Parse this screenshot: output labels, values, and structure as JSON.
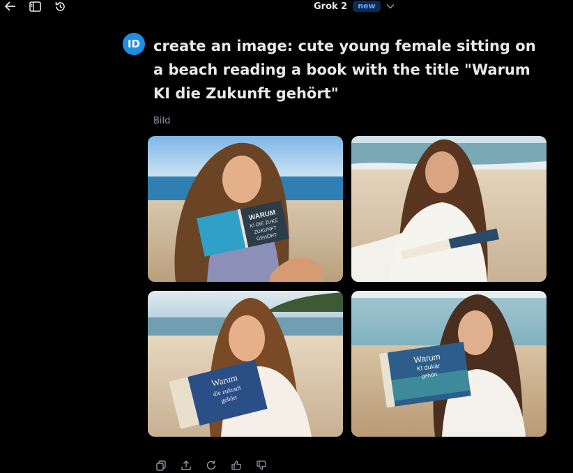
{
  "header": {
    "model_name": "Grok 2",
    "model_badge": "new",
    "icons": [
      "back-arrow-icon",
      "sidebar-toggle-icon",
      "history-icon",
      "chevron-down-icon"
    ]
  },
  "message": {
    "avatar_initials": "ID",
    "prompt": "create an image: cute young female sitting on a beach reading a book with the title \"Warum KI die Zukunft gehört\""
  },
  "result": {
    "type_label": "Bild",
    "images": [
      {
        "book_text": [
          "WARUM",
          "KI DIE ZUKE",
          "ZUKUNFT",
          "GEHÖRT"
        ]
      },
      {
        "book_text": []
      },
      {
        "book_text": [
          "Warum",
          "die zukunft",
          "gehört"
        ]
      },
      {
        "book_text": [
          "Warum",
          "KI dukär",
          "gehört"
        ]
      }
    ]
  },
  "actions": {
    "icons": [
      "copy-icon",
      "share-icon",
      "regenerate-icon",
      "thumbs-up-icon",
      "thumbs-down-icon"
    ]
  },
  "colors": {
    "background": "#000000",
    "avatar": "#1d8ee6",
    "badge_bg": "#0d2a52",
    "badge_text": "#5aa9ff",
    "muted": "#8b98a5"
  }
}
